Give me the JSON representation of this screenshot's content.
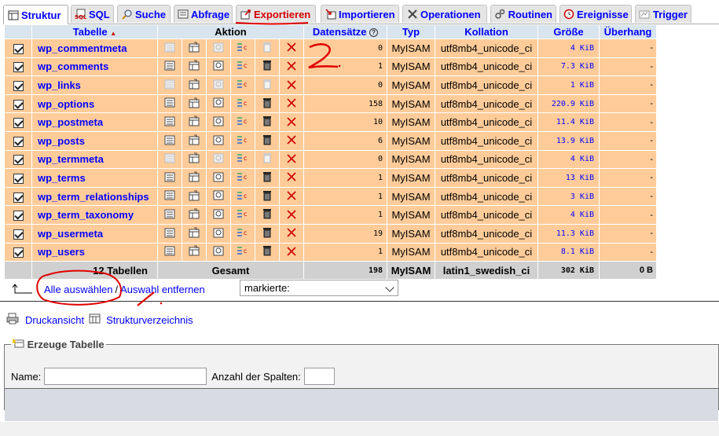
{
  "tabs": [
    {
      "label": "Struktur",
      "icon": "structure-icon"
    },
    {
      "label": "SQL",
      "icon": "sql-icon"
    },
    {
      "label": "Suche",
      "icon": "search-icon"
    },
    {
      "label": "Abfrage",
      "icon": "query-icon"
    },
    {
      "label": "Exportieren",
      "icon": "export-icon"
    },
    {
      "label": "Importieren",
      "icon": "import-icon"
    },
    {
      "label": "Operationen",
      "icon": "operations-icon"
    },
    {
      "label": "Routinen",
      "icon": "routines-icon"
    },
    {
      "label": "Ereignisse",
      "icon": "events-icon"
    },
    {
      "label": "Trigger",
      "icon": "trigger-icon"
    }
  ],
  "table": {
    "headers": {
      "tabelle": "Tabelle",
      "aktion": "Aktion",
      "datensaetze": "Datensätze",
      "typ": "Typ",
      "kollation": "Kollation",
      "groesse": "Größe",
      "ueberhang": "Überhang"
    },
    "rows": [
      {
        "name": "wp_commentmeta",
        "records": "0",
        "type": "MyISAM",
        "collation": "utf8mb4_unicode_ci",
        "size": "4 KiB",
        "overhead": "-",
        "empty": true
      },
      {
        "name": "wp_comments",
        "records": "1",
        "type": "MyISAM",
        "collation": "utf8mb4_unicode_ci",
        "size": "7.3 KiB",
        "overhead": "-",
        "empty": false
      },
      {
        "name": "wp_links",
        "records": "0",
        "type": "MyISAM",
        "collation": "utf8mb4_unicode_ci",
        "size": "1 KiB",
        "overhead": "-",
        "empty": true
      },
      {
        "name": "wp_options",
        "records": "158",
        "type": "MyISAM",
        "collation": "utf8mb4_unicode_ci",
        "size": "220.9 KiB",
        "overhead": "-",
        "empty": false
      },
      {
        "name": "wp_postmeta",
        "records": "10",
        "type": "MyISAM",
        "collation": "utf8mb4_unicode_ci",
        "size": "11.4 KiB",
        "overhead": "-",
        "empty": false
      },
      {
        "name": "wp_posts",
        "records": "6",
        "type": "MyISAM",
        "collation": "utf8mb4_unicode_ci",
        "size": "13.9 KiB",
        "overhead": "-",
        "empty": false
      },
      {
        "name": "wp_termmeta",
        "records": "0",
        "type": "MyISAM",
        "collation": "utf8mb4_unicode_ci",
        "size": "4 KiB",
        "overhead": "-",
        "empty": true
      },
      {
        "name": "wp_terms",
        "records": "1",
        "type": "MyISAM",
        "collation": "utf8mb4_unicode_ci",
        "size": "13 KiB",
        "overhead": "-",
        "empty": false
      },
      {
        "name": "wp_term_relationships",
        "records": "1",
        "type": "MyISAM",
        "collation": "utf8mb4_unicode_ci",
        "size": "3 KiB",
        "overhead": "-",
        "empty": false
      },
      {
        "name": "wp_term_taxonomy",
        "records": "1",
        "type": "MyISAM",
        "collation": "utf8mb4_unicode_ci",
        "size": "4 KiB",
        "overhead": "-",
        "empty": false
      },
      {
        "name": "wp_usermeta",
        "records": "19",
        "type": "MyISAM",
        "collation": "utf8mb4_unicode_ci",
        "size": "11.3 KiB",
        "overhead": "-",
        "empty": false
      },
      {
        "name": "wp_users",
        "records": "1",
        "type": "MyISAM",
        "collation": "utf8mb4_unicode_ci",
        "size": "8.1 KiB",
        "overhead": "-",
        "empty": false
      }
    ],
    "summary": {
      "tables": "12 Tabellen",
      "label": "Gesamt",
      "records": "198",
      "type": "MyISAM",
      "collation": "latin1_swedish_ci",
      "size": "302 KiB",
      "overhead": "0 B"
    }
  },
  "selection": {
    "select_all": "Alle auswählen",
    "separator": "/",
    "deselect_all": "Auswahl entfernen",
    "with_selected": "markierte:"
  },
  "links": {
    "print": "Druckansicht",
    "structure_dict": "Strukturverzeichnis"
  },
  "create_table": {
    "legend": "Erzeuge Tabelle",
    "name_label": "Name:",
    "name_value": "",
    "columns_label": "Anzahl der Spalten:",
    "columns_value": ""
  },
  "annotations": {
    "mark_1": "1.",
    "mark_2": "2."
  },
  "colors": {
    "row_bg": "#ffcc99",
    "header_bg": "#d8e4ee",
    "link": "#0000ff",
    "export_tab": "#d60000",
    "drop_red": "#cc0000",
    "annotation": "#e00000"
  }
}
